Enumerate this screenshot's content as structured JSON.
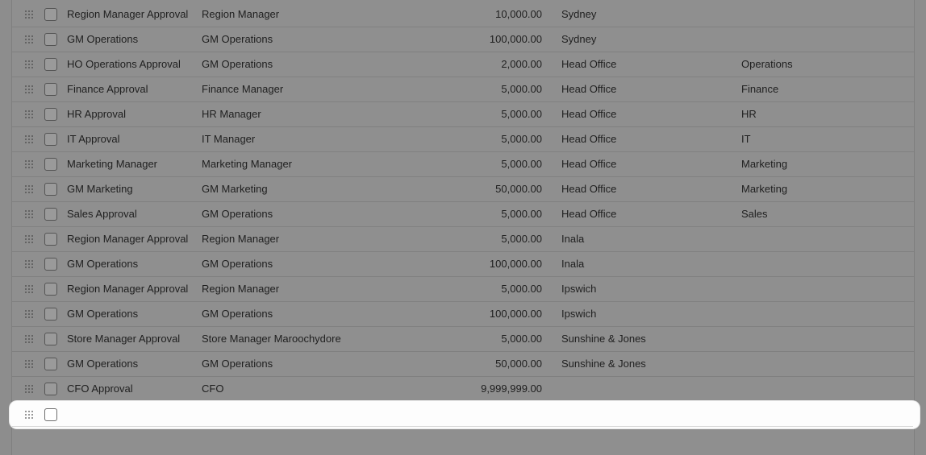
{
  "table": {
    "rows": [
      {
        "name": "Region Manager Approval",
        "role": "Region Manager",
        "amount": "10,000.00",
        "location": "Sydney",
        "department": ""
      },
      {
        "name": "GM Operations",
        "role": "GM Operations",
        "amount": "100,000.00",
        "location": "Sydney",
        "department": ""
      },
      {
        "name": "HO Operations Approval",
        "role": "GM Operations",
        "amount": "2,000.00",
        "location": "Head Office",
        "department": "Operations"
      },
      {
        "name": "Finance Approval",
        "role": "Finance Manager",
        "amount": "5,000.00",
        "location": "Head Office",
        "department": "Finance"
      },
      {
        "name": "HR Approval",
        "role": "HR Manager",
        "amount": "5,000.00",
        "location": "Head Office",
        "department": "HR"
      },
      {
        "name": "IT Approval",
        "role": "IT Manager",
        "amount": "5,000.00",
        "location": "Head Office",
        "department": "IT"
      },
      {
        "name": "Marketing Manager",
        "role": "Marketing Manager",
        "amount": "5,000.00",
        "location": "Head Office",
        "department": "Marketing"
      },
      {
        "name": "GM Marketing",
        "role": "GM Marketing",
        "amount": "50,000.00",
        "location": "Head Office",
        "department": "Marketing"
      },
      {
        "name": "Sales Approval",
        "role": "GM Operations",
        "amount": "5,000.00",
        "location": "Head Office",
        "department": "Sales"
      },
      {
        "name": "Region Manager Approval",
        "role": "Region Manager",
        "amount": "5,000.00",
        "location": "Inala",
        "department": ""
      },
      {
        "name": "GM Operations",
        "role": "GM Operations",
        "amount": "100,000.00",
        "location": "Inala",
        "department": ""
      },
      {
        "name": "Region Manager Approval",
        "role": "Region Manager",
        "amount": "5,000.00",
        "location": "Ipswich",
        "department": ""
      },
      {
        "name": "GM Operations",
        "role": "GM Operations",
        "amount": "100,000.00",
        "location": "Ipswich",
        "department": ""
      },
      {
        "name": "Store Manager Approval",
        "role": "Store Manager Maroochydore",
        "amount": "5,000.00",
        "location": "Sunshine & Jones",
        "department": ""
      },
      {
        "name": "GM Operations",
        "role": "GM Operations",
        "amount": "50,000.00",
        "location": "Sunshine & Jones",
        "department": ""
      },
      {
        "name": "CFO Approval",
        "role": "CFO",
        "amount": "9,999,999.00",
        "location": "",
        "department": ""
      }
    ]
  },
  "icons": {
    "handle": "drag-handle-icon",
    "checkbox": "checkbox"
  }
}
